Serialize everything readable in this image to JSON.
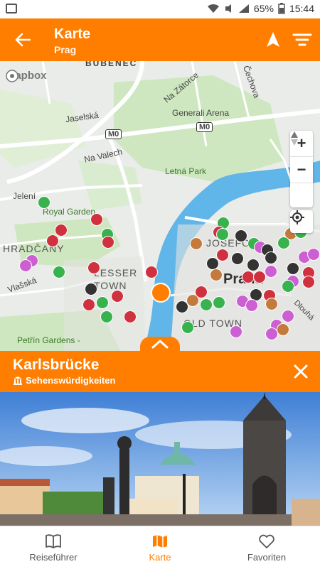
{
  "status": {
    "battery": "65%",
    "time": "15:44"
  },
  "header": {
    "title": "Karte",
    "subtitle": "Prag",
    "back_icon": "arrow-left-icon",
    "nav_icon": "navigation-arrow-icon",
    "filter_icon": "filter-icon"
  },
  "map": {
    "attribution": "mapbox",
    "labels": {
      "bubeneč": "BUBENEČ",
      "na_zatorce": "Na Zátorce",
      "cechova": "Čechova",
      "jaselska": "Jaselská",
      "generali_arena": "Generali Arena",
      "m0_a": "M0",
      "m0_b": "M0",
      "na_valech": "Na Valech",
      "letna_park": "Letná Park",
      "jeleni": "Jelení",
      "royal_garden": "Royal Garden",
      "hradcany": "HRADČANY",
      "josefov": "JOSEFOV",
      "praha": "Praha",
      "lesser_town": "LESSER\nTOWN",
      "vlasska": "Vlašská",
      "old_town": "OLD TOWN",
      "dlouha": "Dlouhá",
      "petrin_gardens": "Petřín Gardens -",
      "zoom_in": "+",
      "zoom_out": "−"
    },
    "colors": {
      "sight": "#d0313f",
      "dark": "#333333",
      "green": "#37b24d",
      "brown": "#c47a3c",
      "purple": "#cc5fd1",
      "selected": "#ff7e00",
      "water": "#60b6e8"
    }
  },
  "panel": {
    "title": "Karlsbrücke",
    "category": "Sehenswürdigkeiten",
    "category_icon": "landmark-icon",
    "close_icon": "close-icon"
  },
  "bottom_nav": [
    {
      "label": "Reiseführer",
      "icon": "book-icon",
      "active": false
    },
    {
      "label": "Karte",
      "icon": "map-icon",
      "active": true
    },
    {
      "label": "Favoriten",
      "icon": "heart-icon",
      "active": false
    }
  ]
}
